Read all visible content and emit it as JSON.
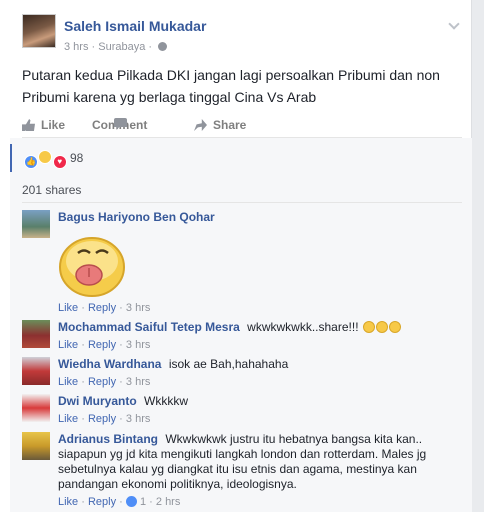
{
  "post": {
    "author": "Saleh Ismail Mukadar",
    "time": "3 hrs",
    "separator": "·",
    "location": "Surabaya",
    "text": "Putaran kedua Pilkada DKI jangan lagi persoalkan Pribumi dan non Pribumi karena yg berlaga tinggal Cina Vs Arab"
  },
  "actions": {
    "like": "Like",
    "comment": "Comment",
    "share": "Share"
  },
  "reactions": {
    "count": "98",
    "types": [
      "like-icon",
      "haha-icon",
      "love-icon"
    ]
  },
  "shares": "201 shares",
  "comments": [
    {
      "name": "Bagus Hariyono Ben Qohar",
      "text": "",
      "like": "Like",
      "reply": "Reply",
      "time": "3 hrs"
    },
    {
      "name": "Mochammad Saiful Tetep Mesra",
      "text": "wkwkwkwkk..share!!!",
      "like": "Like",
      "reply": "Reply",
      "time": "3 hrs"
    },
    {
      "name": "Wiedha Wardhana",
      "text": "isok ae Bah,hahahaha",
      "like": "Like",
      "reply": "Reply",
      "time": "3 hrs"
    },
    {
      "name": "Dwi Muryanto",
      "text": "Wkkkkw",
      "like": "Like",
      "reply": "Reply",
      "time": "3 hrs"
    },
    {
      "name": "Adrianus Bintang",
      "text": "Wkwkwkwk justru itu hebatnya bangsa kita kan.. siapapun yg jd kita mengikuti langkah london dan rotterdam. Males jg sebetulnya kalau yg diangkat itu isu etnis dan agama, mestinya kan pandangan ekonomi politiknya, ideologisnya.",
      "like": "Like",
      "reply": "Reply",
      "likes": "1",
      "time": "2 hrs"
    }
  ],
  "sep": "·",
  "colors": {
    "link": "#365899",
    "accent": "#4267b2",
    "meta": "#90949c"
  }
}
